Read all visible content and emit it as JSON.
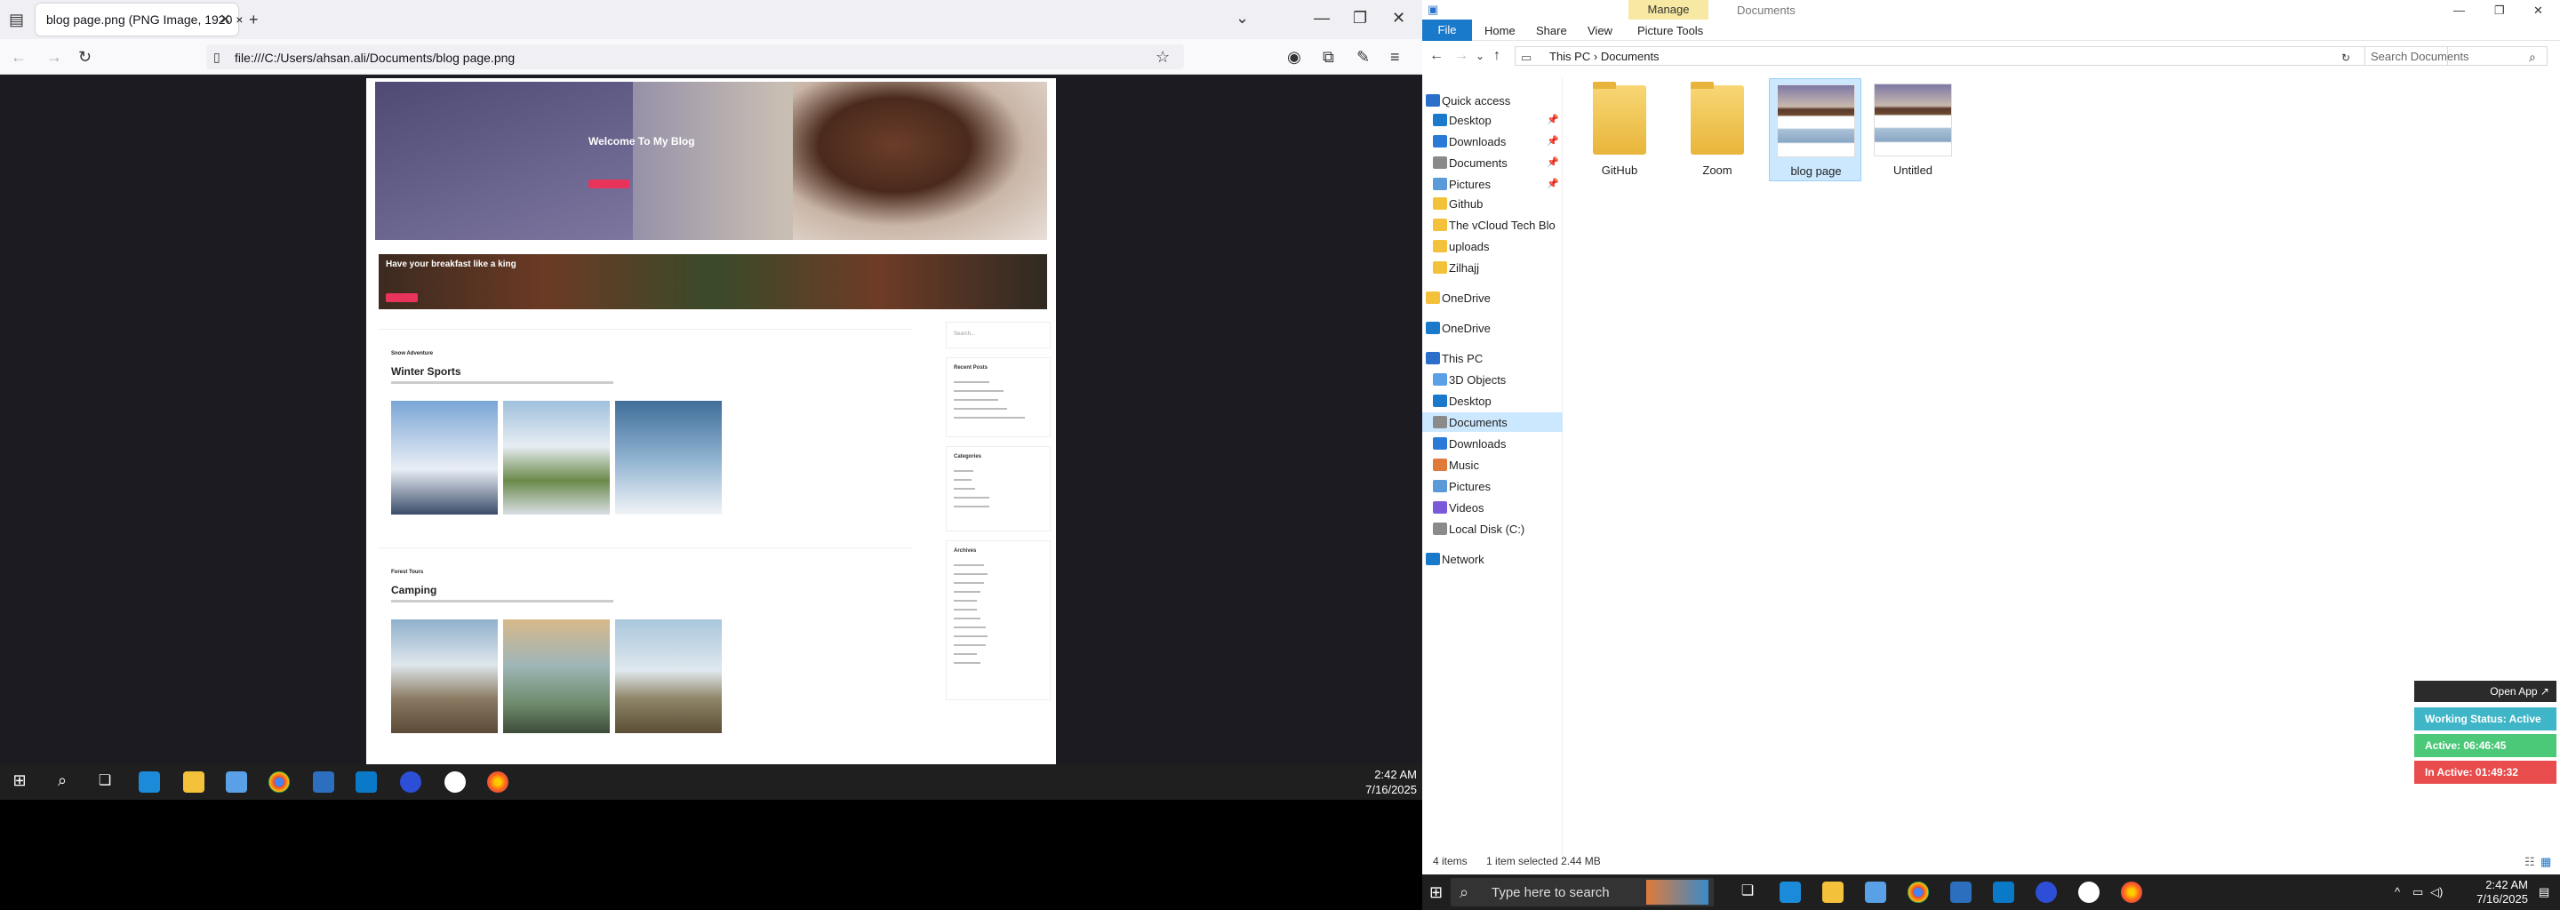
{
  "firefox": {
    "tab_title": "blog page.png (PNG Image, 1920 ×",
    "url": "file:///C:/Users/ahsan.ali/Documents/blog page.png",
    "blog": {
      "hero_title": "Welcome To My Blog",
      "banner_title": "Have your breakfast like a king",
      "posts": [
        {
          "category": "Snow Adventure",
          "title": "Winter Sports"
        },
        {
          "category": "Forest Tours",
          "title": "Camping"
        }
      ],
      "sidebar": {
        "search_placeholder": "Search...",
        "recent_posts": "Recent Posts",
        "categories": "Categories",
        "archives": "Archives"
      }
    }
  },
  "left_taskbar": {
    "time": "2:42 AM",
    "date": "7/16/2025"
  },
  "explorer": {
    "ribbon_context": "Manage",
    "window_title": "Documents",
    "tabs": [
      "File",
      "Home",
      "Share",
      "View",
      "Picture Tools"
    ],
    "address": [
      "This PC",
      "Documents"
    ],
    "search_placeholder": "Search Documents",
    "nav": [
      {
        "label": "Quick access",
        "pinned": false
      },
      {
        "label": "Desktop",
        "pinned": true
      },
      {
        "label": "Downloads",
        "pinned": true
      },
      {
        "label": "Documents",
        "pinned": true
      },
      {
        "label": "Pictures",
        "pinned": true
      },
      {
        "label": "Github",
        "pinned": false
      },
      {
        "label": "The vCloud Tech Blo",
        "pinned": false
      },
      {
        "label": "uploads",
        "pinned": false
      },
      {
        "label": "Zilhajj",
        "pinned": false
      },
      {
        "label": "OneDrive",
        "pinned": false
      },
      {
        "label": "OneDrive",
        "pinned": false
      },
      {
        "label": "This PC",
        "pinned": false
      },
      {
        "label": "3D Objects",
        "pinned": false
      },
      {
        "label": "Desktop",
        "pinned": false
      },
      {
        "label": "Documents",
        "pinned": false,
        "selected": true
      },
      {
        "label": "Downloads",
        "pinned": false
      },
      {
        "label": "Music",
        "pinned": false
      },
      {
        "label": "Pictures",
        "pinned": false
      },
      {
        "label": "Videos",
        "pinned": false
      },
      {
        "label": "Local Disk (C:)",
        "pinned": false
      },
      {
        "label": "Network",
        "pinned": false
      }
    ],
    "files": [
      {
        "name": "GitHub",
        "type": "folder"
      },
      {
        "name": "Zoom",
        "type": "folder"
      },
      {
        "name": "blog page",
        "type": "image",
        "selected": true
      },
      {
        "name": "Untitled",
        "type": "image"
      }
    ],
    "status": {
      "count": "4 items",
      "selection": "1 item selected  2.44 MB"
    }
  },
  "tracker_widget": {
    "open_label": "Open App ↗",
    "working_status": "Working Status: Active",
    "active": "Active: 06:46:45",
    "inactive": "In Active: 01:49:32",
    "colors": {
      "status": "#3fb6c8",
      "active": "#4cc879",
      "inactive": "#e84c4c"
    }
  },
  "right_taskbar": {
    "search_placeholder": "Type here to search",
    "time": "2:42 AM",
    "date": "7/16/2025"
  }
}
